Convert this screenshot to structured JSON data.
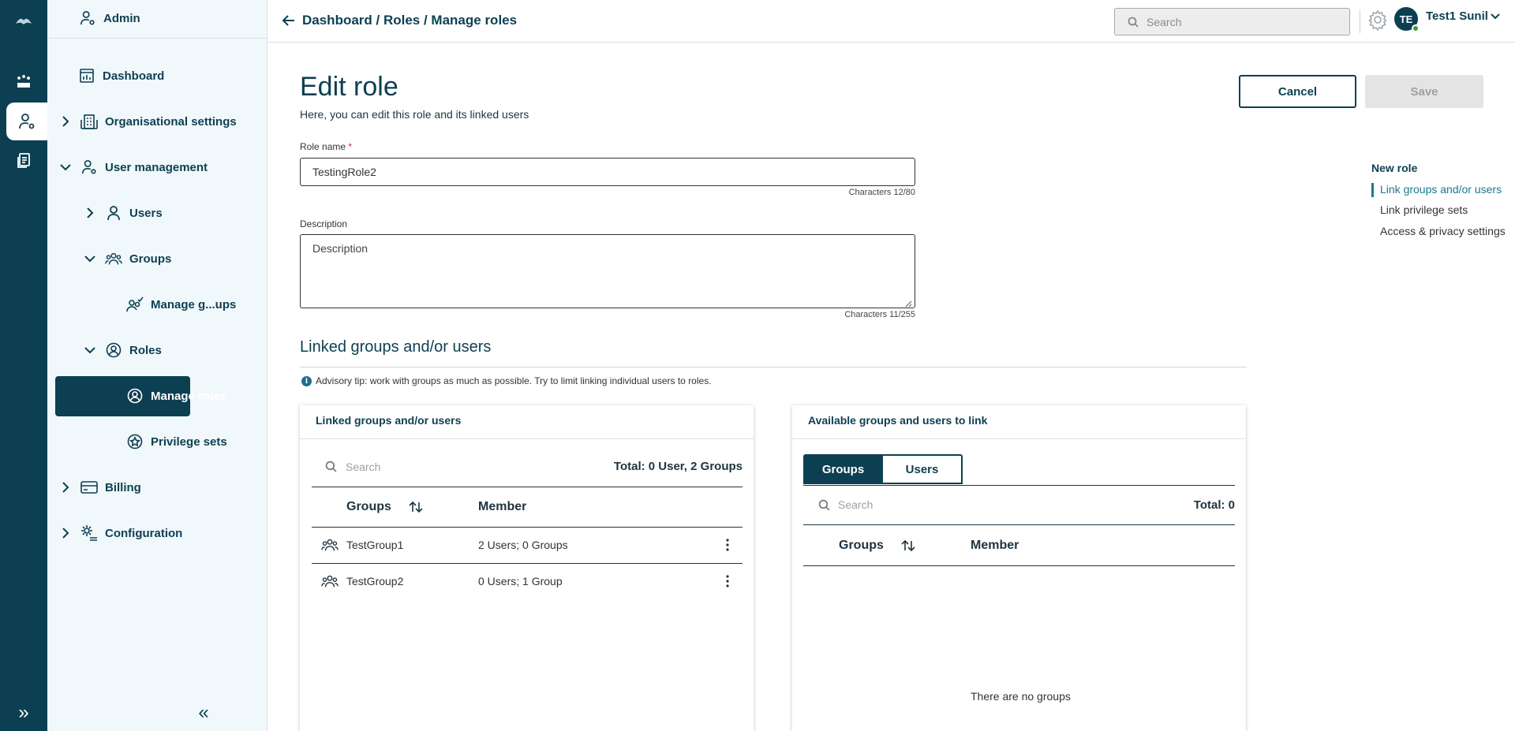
{
  "topbar": {
    "breadcrumb": "Dashboard / Roles / Manage roles",
    "search_placeholder": "Search",
    "user_initials": "TE",
    "user_name": "Test1 Sunil"
  },
  "sidebar": {
    "header": "Admin",
    "items": [
      {
        "label": "Dashboard"
      },
      {
        "label": "Organisational settings"
      },
      {
        "label": "User management"
      },
      {
        "label": "Users"
      },
      {
        "label": "Groups"
      },
      {
        "label": "Manage g...ups"
      },
      {
        "label": "Roles"
      },
      {
        "label": "Manage roles"
      },
      {
        "label": "Privilege sets"
      },
      {
        "label": "Billing"
      },
      {
        "label": "Configuration"
      }
    ]
  },
  "page": {
    "title": "Edit role",
    "subtitle": "Here, you can edit this role and its linked users",
    "cancel_label": "Cancel",
    "save_label": "Save"
  },
  "form": {
    "role_name_label": "Role name",
    "required_mark": "*",
    "role_name_value": "TestingRole2",
    "role_name_counter": "Characters 12/80",
    "description_label": "Description",
    "description_placeholder": "Description",
    "description_counter": "Characters 11/255"
  },
  "linked_section": {
    "title": "Linked groups and/or users",
    "tip": "Advisory tip: work with groups as much as possible. Try to limit linking individual users to roles."
  },
  "right_nav": {
    "heading": "New role",
    "items": [
      "Link groups and/or users",
      "Link privilege sets",
      "Access & privacy settings"
    ]
  },
  "linked_panel": {
    "title": "Linked groups and/or users",
    "search_placeholder": "Search",
    "total": "Total: 0 User, 2 Groups",
    "col_groups": "Groups",
    "col_member": "Member",
    "rows": [
      {
        "name": "TestGroup1",
        "member": "2 Users; 0 Groups"
      },
      {
        "name": "TestGroup2",
        "member": "0 Users; 1 Group"
      }
    ]
  },
  "available_panel": {
    "title": "Available groups and users to link",
    "tab_groups": "Groups",
    "tab_users": "Users",
    "search_placeholder": "Search",
    "total": "Total: 0",
    "col_groups": "Groups",
    "col_member": "Member",
    "empty": "There are no groups"
  }
}
